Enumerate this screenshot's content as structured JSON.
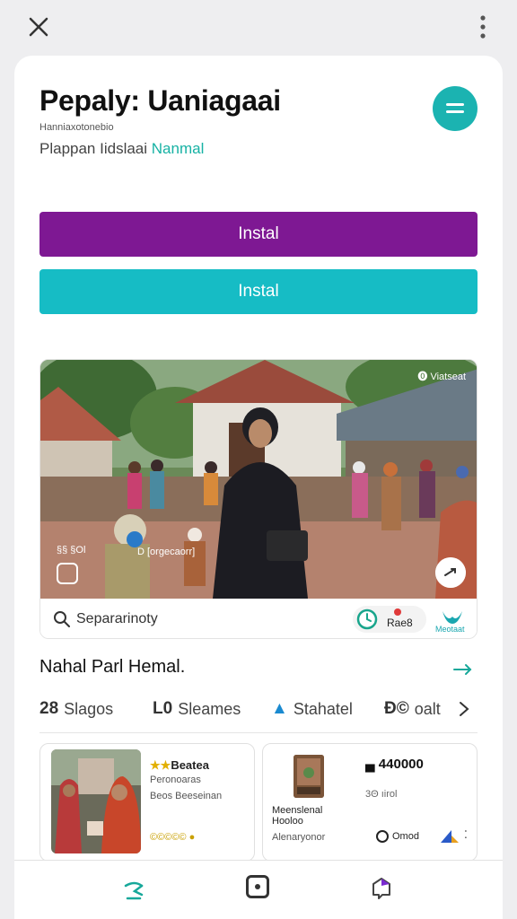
{
  "header": {
    "title": "Pepaly: Uaniagaai",
    "small_caption": "Hanniaxotonebio",
    "subtitle_prefix": "Plappan Iidslaai ",
    "subtitle_accent": "Nanmal"
  },
  "actions": {
    "primary_label": "Instal",
    "secondary_label": "Instal"
  },
  "hero": {
    "tag": "⓿ Viatseat",
    "caption_left": "§§ §Ol",
    "caption_mid": "D [orgecaorr]",
    "search_label": "Separarinoty",
    "pill_label": "Rae8",
    "brand_label": "Meotaat"
  },
  "section": {
    "title": "Nahal Parl Hemal."
  },
  "filters": [
    {
      "icon": "28",
      "label": "Slagos"
    },
    {
      "icon": "L0",
      "label": "Sleames"
    },
    {
      "icon": "▲",
      "label": "Stahatel"
    },
    {
      "icon": "Đ©",
      "label": "oalt"
    }
  ],
  "products": [
    {
      "stars": "★★",
      "title": "Beatea",
      "line1": "Peronoaras",
      "line2": "Beos Beeseinan",
      "rating": "©©©©© ●"
    },
    {
      "price": "▄ 440000",
      "sub": "3Θ ıirol",
      "name": "Meenslenal Hooloo",
      "desc": "Alenaryonor",
      "cta": "Omod",
      "more": "⁚"
    }
  ],
  "colors": {
    "primary": "#7e1893",
    "secondary": "#16bcc5",
    "accent": "#17b2a4"
  }
}
